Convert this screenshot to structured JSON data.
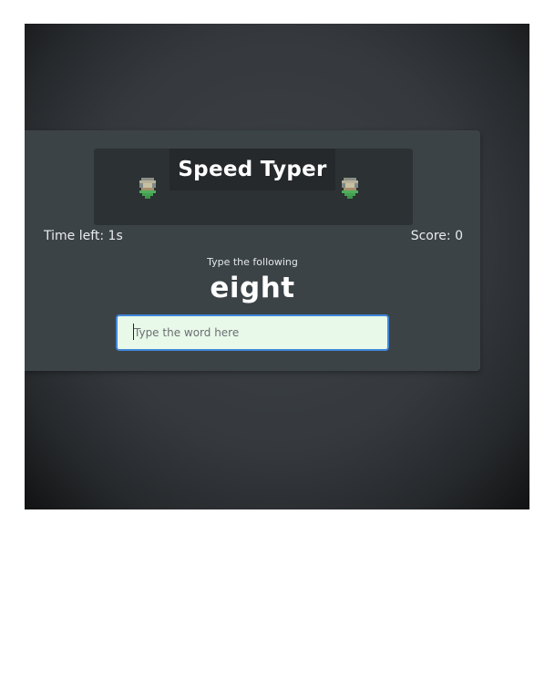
{
  "game": {
    "title": "Speed Typer",
    "sprite_icon": "pixel-character-icon",
    "time_left_label": "Time left: 1s",
    "score_label": "Score: 0",
    "instruction": "Type the following",
    "current_word": "eight",
    "input": {
      "placeholder": "Type the word here",
      "value": ""
    }
  },
  "colors": {
    "background": "#35393d",
    "card": "#3c4347",
    "title_box": "#2c3134",
    "input_background": "#e8f8e9",
    "input_border": "#3f87d8",
    "sprite_green": "#4fae5c"
  }
}
